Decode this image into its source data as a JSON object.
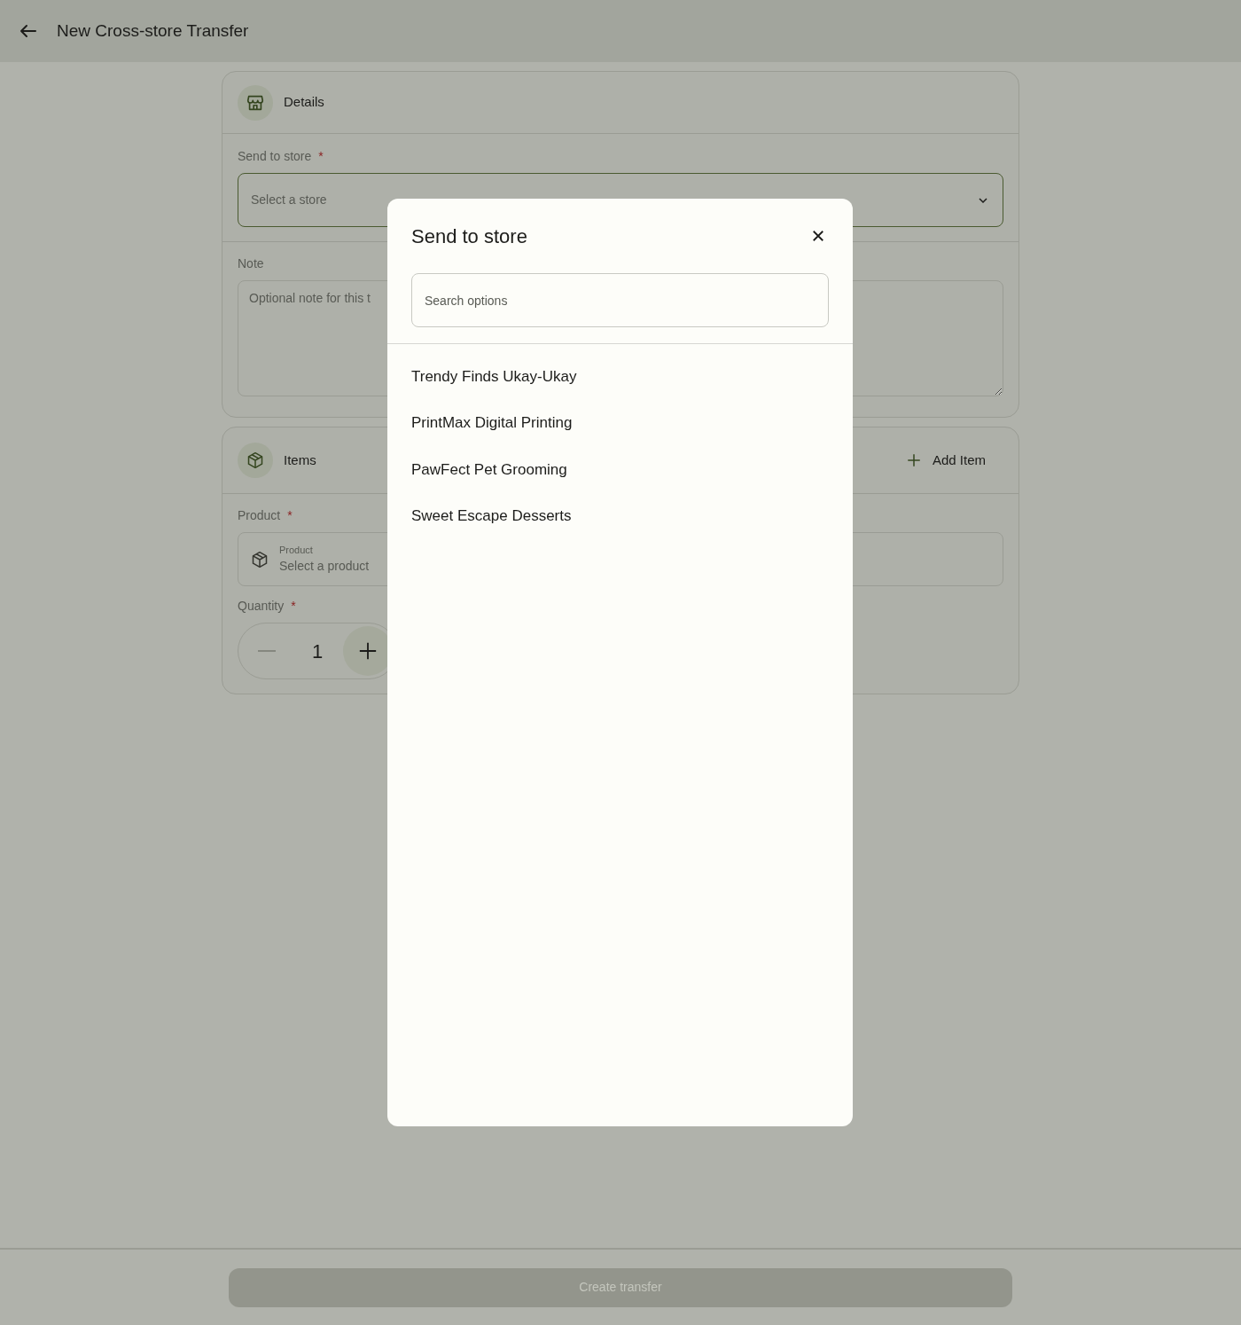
{
  "header": {
    "title": "New Cross-store Transfer"
  },
  "details": {
    "title": "Details",
    "store_field": {
      "label": "Send to store",
      "required_mark": "*",
      "placeholder": "Select a store"
    },
    "note_field": {
      "label": "Note",
      "placeholder": "Optional note for this t"
    }
  },
  "items": {
    "title": "Items",
    "add_button": "Add Item",
    "product_field": {
      "label": "Product",
      "required_mark": "*",
      "caption": "Product",
      "placeholder": "Select a product"
    },
    "quantity": {
      "label": "Quantity",
      "required_mark": "*",
      "value": "1"
    }
  },
  "footer": {
    "button": "Create transfer",
    "disabled": true
  },
  "dialog": {
    "title": "Send to store",
    "search": {
      "placeholder": "Search options"
    },
    "options": [
      {
        "label": "Trendy Finds Ukay-Ukay"
      },
      {
        "label": "PrintMax Digital Printing"
      },
      {
        "label": "PawFect Pet Grooming"
      },
      {
        "label": "Sweet Escape Desserts"
      }
    ]
  }
}
